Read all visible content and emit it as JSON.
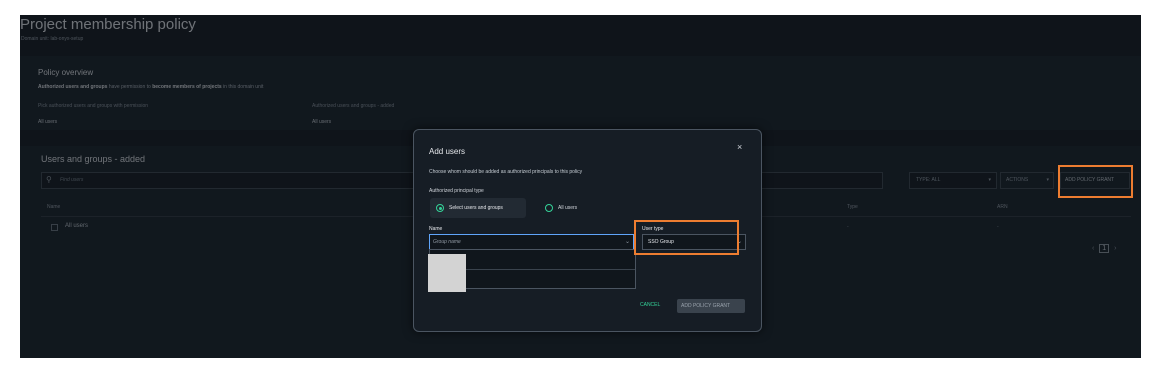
{
  "page": {
    "title": "Project membership policy",
    "subtitle": "Domain unit: lab-onyx-setup"
  },
  "overview": {
    "title": "Policy overview",
    "description_bold_1": "Authorized users and groups",
    "description_mid": " have permission to ",
    "description_bold_2": "become members of projects",
    "description_end": " in this domain unit",
    "label_1": "Pick authorized users and groups with permission",
    "label_2": "Authorized users and groups - added",
    "value_1": "All users",
    "value_2": "All users"
  },
  "users_groups": {
    "title": "Users and groups - added",
    "search_placeholder": "Find users",
    "type_filter": "TYPE: ALL",
    "actions_label": "ACTIONS",
    "add_grant_label": "ADD POLICY GRANT",
    "columns": [
      "Name",
      "Type",
      "ARN"
    ],
    "rows": [
      {
        "name": "All users",
        "type": "-",
        "arn": "-"
      }
    ],
    "pager": {
      "prev": "‹",
      "current": "1",
      "next": "›"
    }
  },
  "modal": {
    "title": "Add users",
    "close": "×",
    "description": "Choose whom should be added as authorized principals to this policy",
    "principal_type_label": "Authorized principal type",
    "option_selected": "Select users and groups",
    "option_all": "All users",
    "name_label": "Name",
    "name_placeholder": "Group name",
    "user_type_label": "User type",
    "user_type_value": "SSO Group",
    "cancel_label": "CANCEL",
    "add_label": "ADD POLICY GRANT"
  },
  "icons": {
    "search": "search-icon",
    "chevron": "chevron-down-icon",
    "close": "close-icon"
  },
  "colors": {
    "highlight": "#ed7d31",
    "accent": "#34d399",
    "focus": "#60a5fa",
    "background": "#0f141a"
  }
}
